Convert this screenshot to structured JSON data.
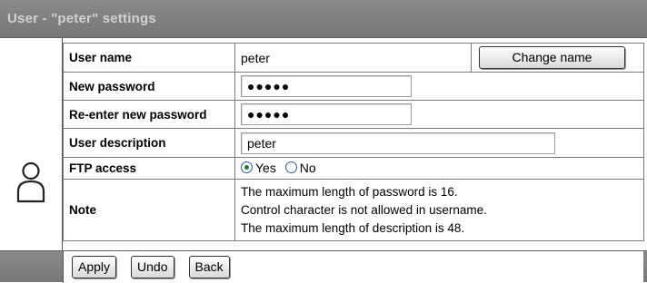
{
  "window": {
    "title": "User - \"peter\" settings"
  },
  "form": {
    "username": {
      "label": "User name",
      "value": "peter",
      "change_button": "Change name"
    },
    "new_password": {
      "label": "New password",
      "value": "●●●●●"
    },
    "reenter_password": {
      "label": "Re-enter new password",
      "value": "●●●●●"
    },
    "description": {
      "label": "User description",
      "value": "peter"
    },
    "ftp_access": {
      "label": "FTP access",
      "options": [
        {
          "label": "Yes",
          "selected": true
        },
        {
          "label": "No",
          "selected": false
        }
      ]
    },
    "note": {
      "label": "Note",
      "lines": [
        "The maximum length of password is 16.",
        "Control character is not allowed in username.",
        "The maximum length of description is 48."
      ]
    }
  },
  "actions": {
    "apply": "Apply",
    "undo": "Undo",
    "back": "Back"
  },
  "icons": {
    "user": "user-icon"
  },
  "colors": {
    "header_bg": "#808080",
    "title_text": "#d2d2d2",
    "radio_checked": "#1f7a2e"
  }
}
